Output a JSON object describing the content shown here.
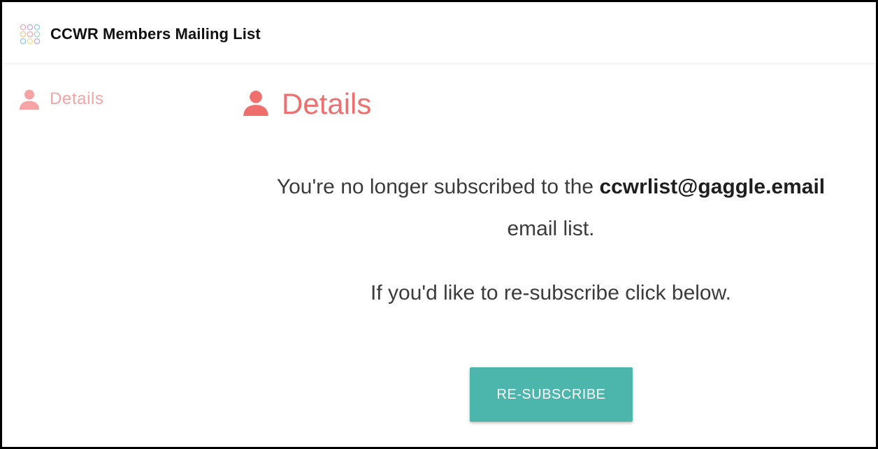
{
  "header": {
    "title": "CCWR Members Mailing List",
    "logo_icon": "gaggle-dots-logo-icon"
  },
  "sidebar": {
    "items": [
      {
        "label": "Details",
        "icon": "person-icon"
      }
    ]
  },
  "main": {
    "title": "Details",
    "title_icon": "person-icon",
    "message_prefix": "You're no longer subscribed to the ",
    "list_email": "ccwrlist@gaggle.email",
    "message_suffix": "email list.",
    "resubscribe_prompt": "If you'd like to re-subscribe click below.",
    "resubscribe_label": "RE-SUBSCRIBE"
  },
  "colors": {
    "accent": "#ef6e6e",
    "sidebar_text": "#f5a3a4",
    "button": "#4db6ac"
  }
}
